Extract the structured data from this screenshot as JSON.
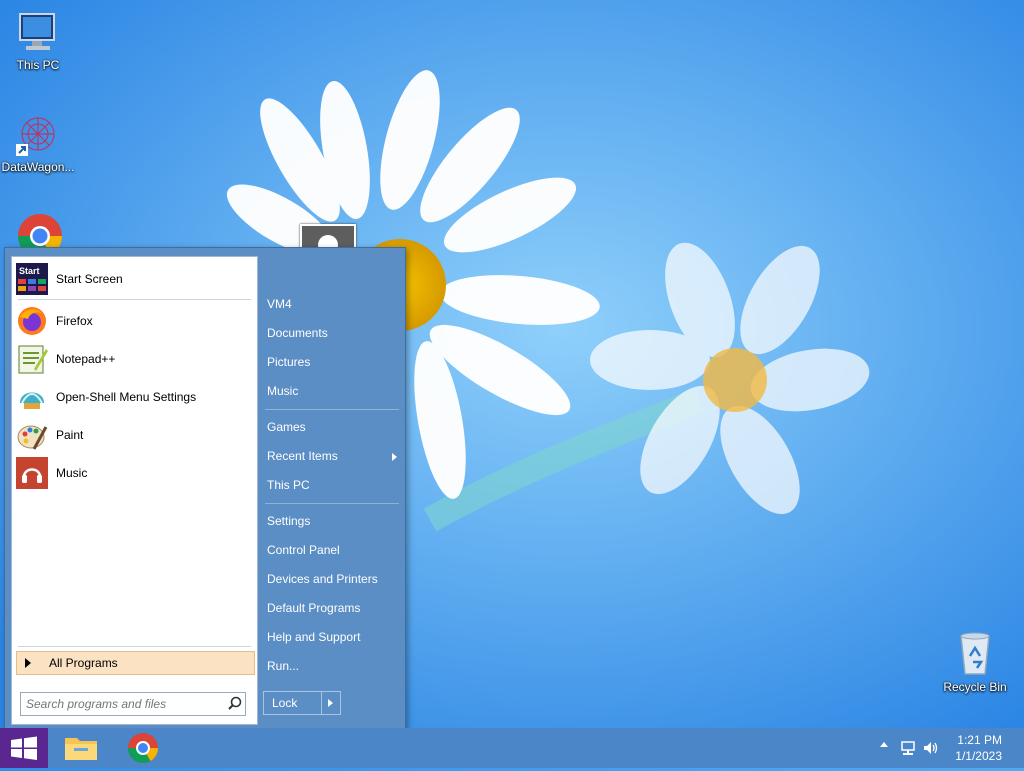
{
  "desktop": {
    "icons": [
      {
        "label": "This PC",
        "icon": "computer-icon"
      },
      {
        "label": "DataWagon...",
        "icon": "datawagon-icon"
      },
      {
        "label": "",
        "icon": "chrome-icon"
      },
      {
        "label": "Recycle Bin",
        "icon": "recycle-bin-icon"
      }
    ]
  },
  "start_menu": {
    "programs": [
      {
        "label": "Start Screen",
        "icon": "start-screen-icon",
        "icon_text": "Start"
      },
      {
        "label": "Firefox",
        "icon": "firefox-icon"
      },
      {
        "label": "Notepad++",
        "icon": "notepadpp-icon"
      },
      {
        "label": "Open-Shell Menu Settings",
        "icon": "shell-settings-icon"
      },
      {
        "label": "Paint",
        "icon": "paint-icon"
      },
      {
        "label": "Music",
        "icon": "music-icon"
      }
    ],
    "all_programs": "All Programs",
    "search_placeholder": "Search programs and files",
    "right_items": [
      {
        "label": "VM4"
      },
      {
        "label": "Documents"
      },
      {
        "label": "Pictures"
      },
      {
        "label": "Music"
      },
      {
        "label": "Games"
      },
      {
        "label": "Recent Items",
        "submenu": true
      },
      {
        "label": "This PC"
      },
      {
        "label": "Settings"
      },
      {
        "label": "Control Panel"
      },
      {
        "label": "Devices and Printers"
      },
      {
        "label": "Default Programs"
      },
      {
        "label": "Help and Support"
      },
      {
        "label": "Run..."
      }
    ],
    "lock_label": "Lock"
  },
  "taskbar": {
    "apps": [
      {
        "icon": "file-explorer-icon"
      },
      {
        "icon": "chrome-icon"
      }
    ],
    "tray": {
      "time": "1:21 PM",
      "date": "1/1/2023"
    }
  },
  "colors": {
    "start_menu_blue": "#5b8ec4",
    "start_button": "#5a2790",
    "taskbar": "#4b86c9",
    "all_programs_highlight": "#fbe2c2"
  }
}
